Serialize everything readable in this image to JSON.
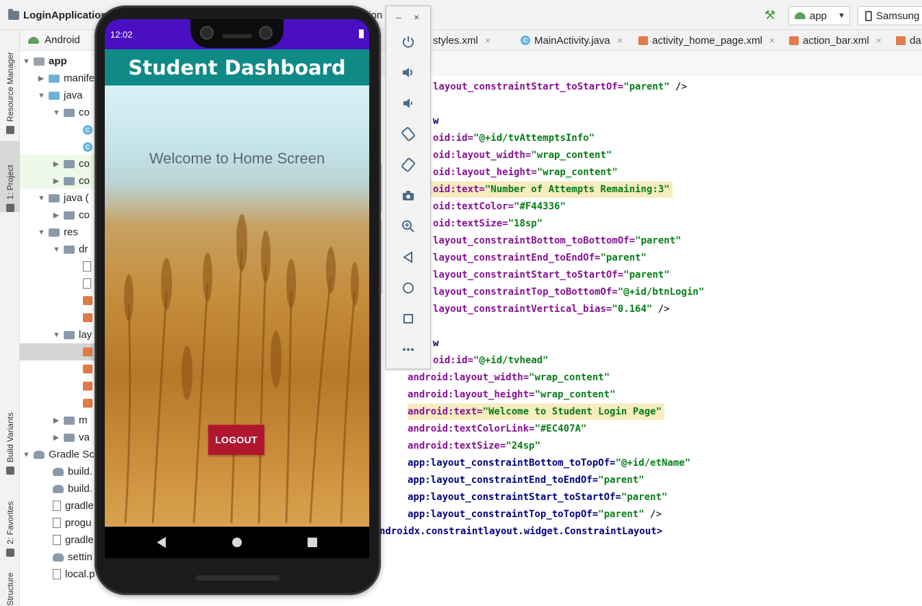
{
  "ide": {
    "project_title": "LoginApplication",
    "title_fragment": "tion",
    "run_config": "app",
    "device": "Samsung"
  },
  "left_strip": {
    "resource_manager": "Resource Manager",
    "project": "1: Project",
    "build_variants": "Build Variants",
    "favorites": "2: Favorites",
    "structure": "Structure"
  },
  "project_panel": {
    "view_selector": "Android",
    "tree": [
      {
        "label": "app"
      },
      {
        "label": "manifests"
      },
      {
        "label": "java"
      },
      {
        "label": "co"
      },
      {
        "label": "co"
      },
      {
        "label": "co"
      },
      {
        "label": "java ("
      },
      {
        "label": "co"
      },
      {
        "label": "res"
      },
      {
        "label": "dr"
      },
      {
        "label": "lay"
      },
      {
        "label": "m"
      },
      {
        "label": "va"
      },
      {
        "label": "Gradle Sc"
      },
      {
        "label": "build."
      },
      {
        "label": "build."
      },
      {
        "label": "gradle"
      },
      {
        "label": "progu"
      },
      {
        "label": "gradle"
      },
      {
        "label": "settin"
      },
      {
        "label": "local.p"
      }
    ]
  },
  "editor_tabs": [
    {
      "label": "styles.xml"
    },
    {
      "label": "MainActivity.java"
    },
    {
      "label": "activity_home_page.xml"
    },
    {
      "label": "action_bar.xml"
    },
    {
      "label": "da"
    }
  ],
  "code": {
    "l1_attr": "layout_constraintStart_toStartOf=",
    "l1_val": "\"parent\"",
    "l1_end": " />",
    "l2_tag": "w",
    "l3_attr": "oid:id=",
    "l3_val": "\"@+id/tvAttemptsInfo\"",
    "l4_attr": "oid:layout_width=",
    "l4_val": "\"wrap_content\"",
    "l5_attr": "oid:layout_height=",
    "l5_val": "\"wrap_content\"",
    "l6_attr": "oid:text=",
    "l6_val": "\"Number of Attempts Remaining:3\"",
    "l7_attr": "oid:textColor=",
    "l7_val": "\"#F44336\"",
    "l8_attr": "oid:textSize=",
    "l8_val": "\"18sp\"",
    "l9_attr": "layout_constraintBottom_toBottomOf=",
    "l9_val": "\"parent\"",
    "l10_attr": "layout_constraintEnd_toEndOf=",
    "l10_val": "\"parent\"",
    "l11_attr": "layout_constraintStart_toStartOf=",
    "l11_val": "\"parent\"",
    "l12_attr": "layout_constraintTop_toBottomOf=",
    "l12_val": "\"@+id/btnLogin\"",
    "l13_attr": "layout_constraintVertical_bias=",
    "l13_val": "\"0.164\"",
    "l13_end": " />",
    "l14_tag": "w",
    "l15_attr": "oid:id=",
    "l15_val": "\"@+id/tvhead\"",
    "l16_attr": "android:layout_width=",
    "l16_val": "\"wrap_content\"",
    "l17_attr": "android:layout_height=",
    "l17_val": "\"wrap_content\"",
    "l18_attr": "android:text=",
    "l18_val": "\"Welcome to Student Login Page\"",
    "l19_attr": "android:textColorLink=",
    "l19_val": "\"#EC407A\"",
    "l20_attr": "android:textSize=",
    "l20_val": "\"24sp\"",
    "l21_attr": "app:layout_constraintBottom_toTopOf=",
    "l21_val": "\"@+id/etName\"",
    "l22_attr": "app:layout_constraintEnd_toEndOf=",
    "l22_val": "\"parent\"",
    "l23_attr": "app:layout_constraintStart_toStartOf=",
    "l23_val": "\"parent\"",
    "l24_attr": "app:layout_constraintTop_toTopOf=",
    "l24_val": "\"parent\"",
    "l24_end": " />",
    "l25_close": "ndroidx.constraintlayout.widget.ConstraintLayout>"
  },
  "emulator_controls": {
    "minimize": "–",
    "close": "×",
    "buttons": [
      "power-icon",
      "volume-up-icon",
      "volume-down-icon",
      "rotate-left-icon",
      "rotate-right-icon",
      "camera-icon",
      "zoom-icon",
      "back-icon",
      "home-icon",
      "overview-icon",
      "more-icon"
    ]
  },
  "phone": {
    "status_time": "12:02",
    "action_bar_title": "Student Dashboard",
    "welcome_text": "Welcome to Home Screen",
    "logout_label": "LOGOUT",
    "action_bar_color": "#0F8A87",
    "status_bar_color": "#4A0FC2",
    "button_color": "#B0172F"
  }
}
